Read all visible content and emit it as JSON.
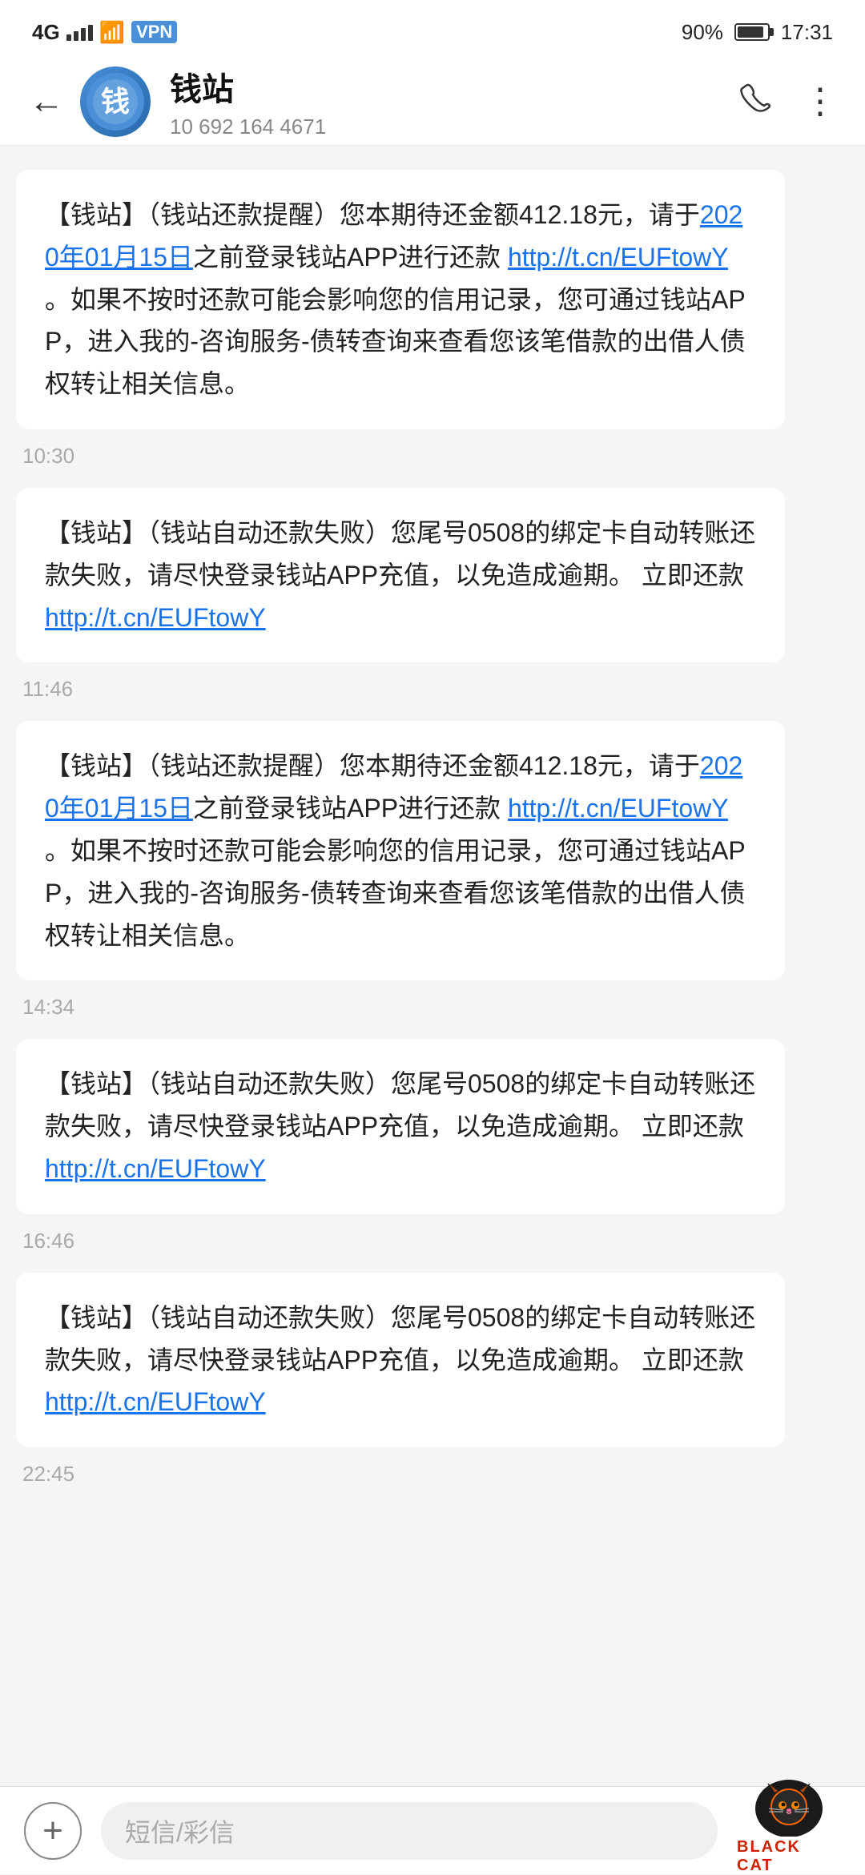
{
  "statusBar": {
    "signal": "4G",
    "battery": "90%",
    "time": "17:31"
  },
  "header": {
    "contactName": "钱站",
    "contactNumber": "10 692 164 4671",
    "backLabel": "←",
    "phoneIcon": "phone",
    "moreIcon": "more"
  },
  "messages": [
    {
      "id": "msg1",
      "text_parts": [
        {
          "type": "text",
          "content": "【钱站】（钱站还款提醒）您本期待还金额412.18元，请于"
        },
        {
          "type": "link",
          "content": "2020年01月15日"
        },
        {
          "type": "text",
          "content": "之前登录钱站APP进行还款 "
        },
        {
          "type": "link",
          "content": "http://t.cn/EUFtowY"
        },
        {
          "type": "text",
          "content": " 。如果不按时还款可能会影响您的信用记录，您可通过钱站APP，进入我的-咨询服务-债转查询来查看您该笔借款的出借人债权转让相关信息。"
        }
      ],
      "timestamp": "10:30"
    },
    {
      "id": "msg2",
      "text_parts": [
        {
          "type": "text",
          "content": "【钱站】（钱站自动还款失败）您尾号0508的绑定卡自动转账还款失败，请尽快登录钱站APP充值，以免造成逾期。  立即还款 "
        },
        {
          "type": "link",
          "content": "http://t.cn/EUFtowY"
        }
      ],
      "timestamp": "11:46"
    },
    {
      "id": "msg3",
      "text_parts": [
        {
          "type": "text",
          "content": "【钱站】（钱站还款提醒）您本期待还金额412.18元，请于"
        },
        {
          "type": "link",
          "content": "2020年01月15日"
        },
        {
          "type": "text",
          "content": "之前登录钱站APP进行还款 "
        },
        {
          "type": "link",
          "content": "http://t.cn/EUFtowY"
        },
        {
          "type": "text",
          "content": " 。如果不按时还款可能会影响您的信用记录，您可通过钱站APP，进入我的-咨询服务-债转查询来查看您该笔借款的出借人债权转让相关信息。"
        }
      ],
      "timestamp": "14:34"
    },
    {
      "id": "msg4",
      "text_parts": [
        {
          "type": "text",
          "content": "【钱站】（钱站自动还款失败）您尾号0508的绑定卡自动转账还款失败，请尽快登录钱站APP充值，以免造成逾期。  立即还款 "
        },
        {
          "type": "link",
          "content": "http://t.cn/EUFtowY"
        }
      ],
      "timestamp": "16:46"
    },
    {
      "id": "msg5",
      "text_parts": [
        {
          "type": "text",
          "content": "【钱站】（钱站自动还款失败）您尾号0508的绑定卡自动转账还款失败，请尽快登录钱站APP充值，以免造成逾期。  立即还款 "
        },
        {
          "type": "link",
          "content": "http://t.cn/EUFtowY"
        }
      ],
      "timestamp": "22:45"
    }
  ],
  "bottomBar": {
    "addLabel": "+",
    "inputPlaceholder": "短信/彩信",
    "blackCatLabel": "BLACK CAT"
  }
}
